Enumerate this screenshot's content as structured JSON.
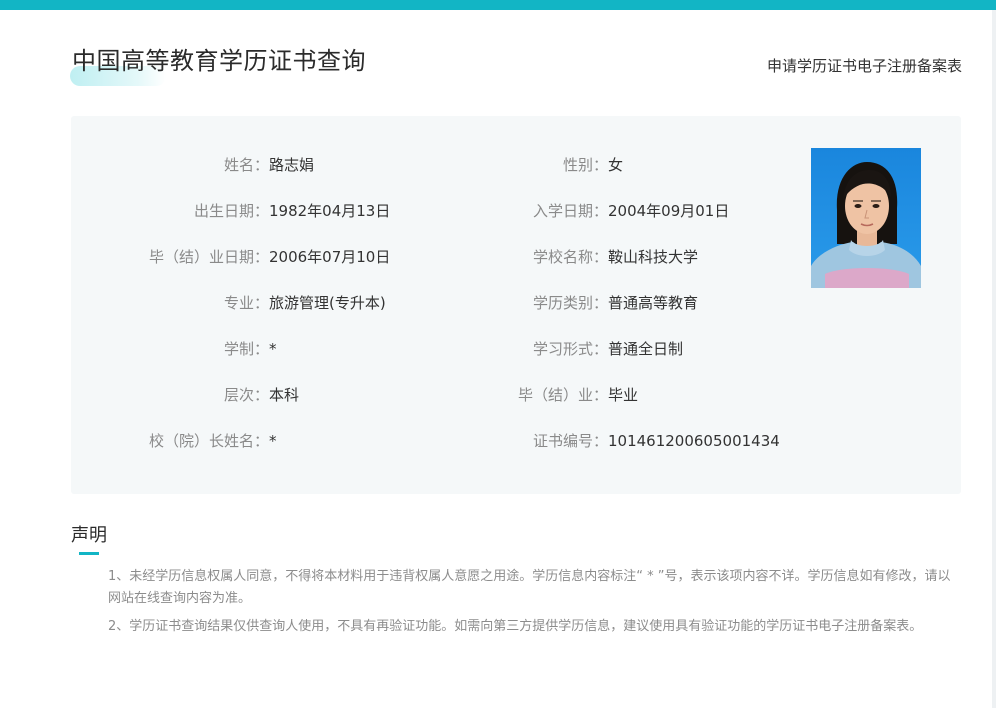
{
  "colors": {
    "accent": "#12b5c5",
    "panel_bg": "#f5f8f9",
    "label": "#8a8a8a",
    "value": "#333333"
  },
  "header": {
    "title": "中国高等教育学历证书查询",
    "apply_link": "申请学历证书电子注册备案表"
  },
  "record": {
    "name": {
      "label": "姓名：",
      "value": "路志娟"
    },
    "gender": {
      "label": "性别：",
      "value": "女"
    },
    "birth_date": {
      "label": "出生日期：",
      "value": "1982年04月13日"
    },
    "enroll_date": {
      "label": "入学日期：",
      "value": "2004年09月01日"
    },
    "grad_date": {
      "label": "毕（结）业日期：",
      "value": "2006年07月10日"
    },
    "school": {
      "label": "学校名称：",
      "value": "鞍山科技大学"
    },
    "major": {
      "label": "专业：",
      "value": "旅游管理(专升本)"
    },
    "edu_type": {
      "label": "学历类别：",
      "value": "普通高等教育"
    },
    "duration": {
      "label": "学制：",
      "value": "*"
    },
    "study_form": {
      "label": "学习形式：",
      "value": "普通全日制"
    },
    "level": {
      "label": "层次：",
      "value": "本科"
    },
    "grad_status": {
      "label": "毕（结）业：",
      "value": "毕业"
    },
    "president": {
      "label": "校（院）长姓名：",
      "value": "*"
    },
    "cert_no": {
      "label": "证书编号：",
      "value": "101461200605001434"
    }
  },
  "statement": {
    "heading": "声明",
    "items": [
      "1、未经学历信息权属人同意，不得将本材料用于违背权属人意愿之用途。学历信息内容标注“ * ”号，表示该项内容不详。学历信息如有修改，请以网站在线查询内容为准。",
      "2、学历证书查询结果仅供查询人使用，不具有再验证功能。如需向第三方提供学历信息，建议使用具有验证功能的学历证书电子注册备案表。"
    ]
  }
}
